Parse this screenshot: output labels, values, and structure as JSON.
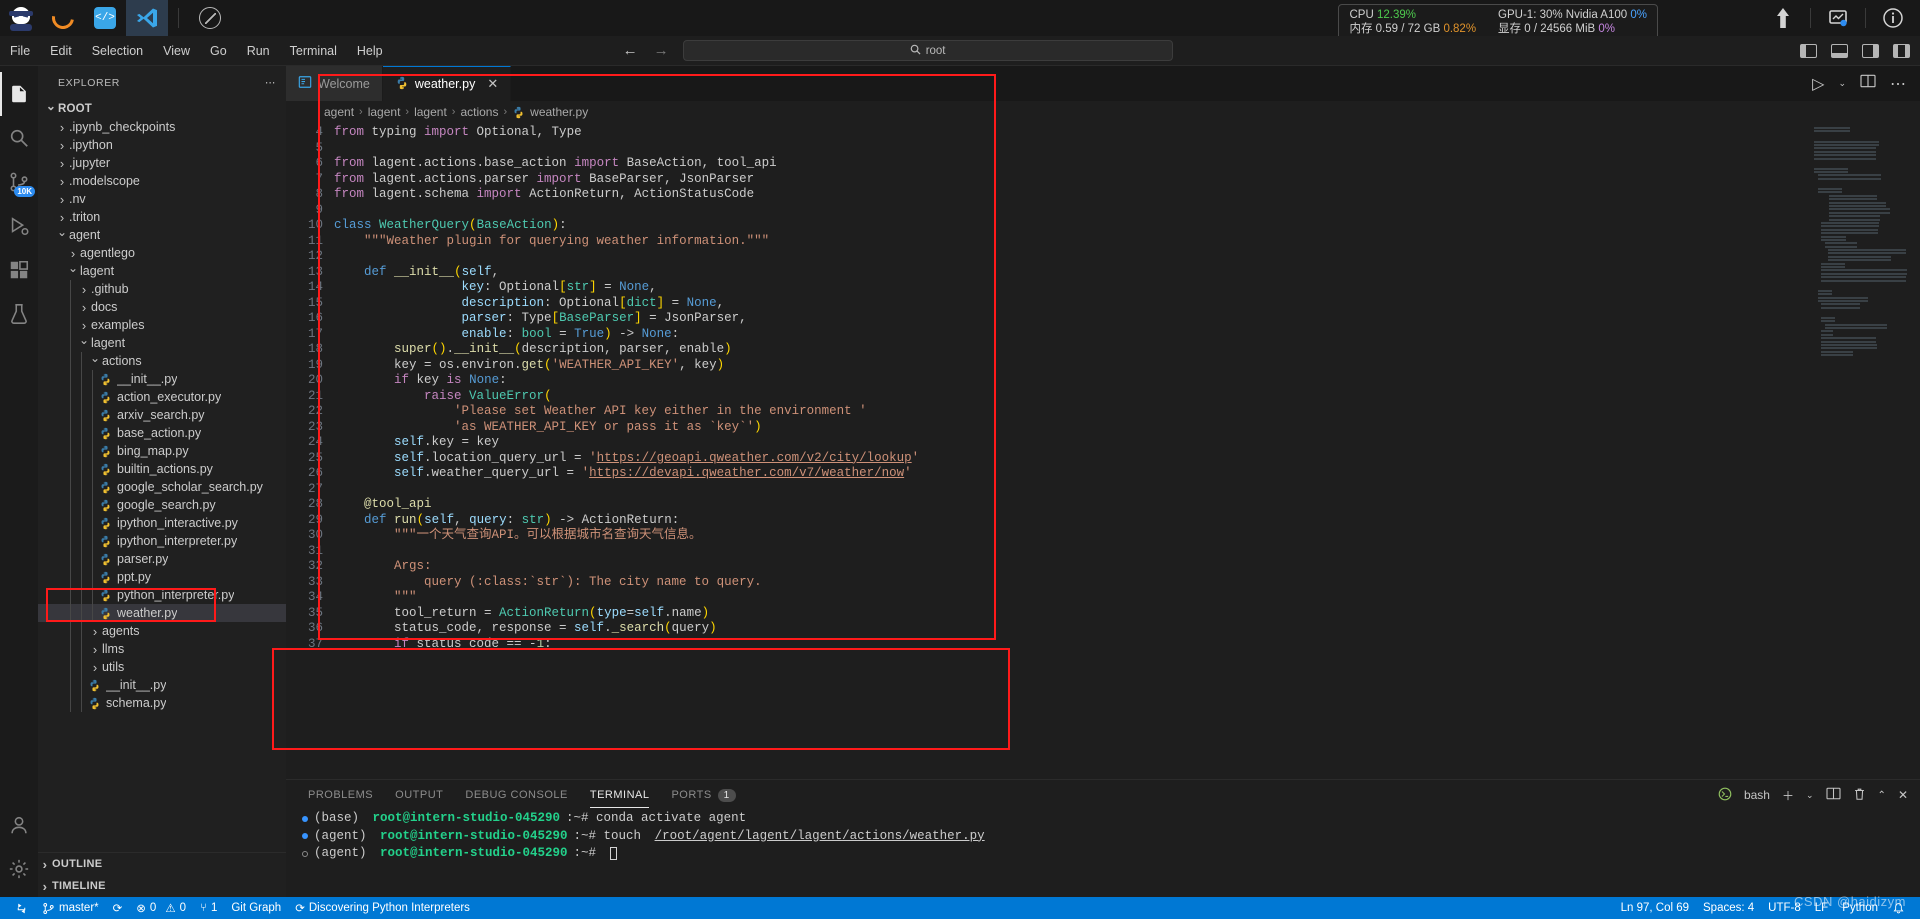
{
  "topstrip": {
    "apps": [
      "ninja-logo",
      "moon-logo",
      "code-logo",
      "vscode-logo"
    ],
    "sysmon": {
      "cpu_label": "CPU",
      "cpu_value": "12.39%",
      "gpu_label": "GPU-1: 30% Nvidia A100",
      "gpu_value": "0%",
      "mem_label": "内存 0.59 / 72 GB",
      "mem_value": "0.82%",
      "vram_label": "显存 0 / 24566 MiB",
      "vram_value": "0%"
    }
  },
  "menubar": {
    "items": [
      "File",
      "Edit",
      "Selection",
      "View",
      "Go",
      "Run",
      "Terminal",
      "Help"
    ],
    "search_value": "root",
    "back_label": "←",
    "forward_label": "→"
  },
  "sidebar": {
    "title": "EXPLORER",
    "root_label": "ROOT",
    "tree": [
      {
        "label": ".ipynb_checkpoints",
        "depth": 1,
        "type": "folder",
        "state": "collapsed"
      },
      {
        "label": ".ipython",
        "depth": 1,
        "type": "folder",
        "state": "collapsed"
      },
      {
        "label": ".jupyter",
        "depth": 1,
        "type": "folder",
        "state": "collapsed"
      },
      {
        "label": ".modelscope",
        "depth": 1,
        "type": "folder",
        "state": "collapsed"
      },
      {
        "label": ".nv",
        "depth": 1,
        "type": "folder",
        "state": "collapsed"
      },
      {
        "label": ".triton",
        "depth": 1,
        "type": "folder",
        "state": "collapsed"
      },
      {
        "label": "agent",
        "depth": 1,
        "type": "folder",
        "state": "expanded"
      },
      {
        "label": "agentlego",
        "depth": 2,
        "type": "folder",
        "state": "collapsed"
      },
      {
        "label": "lagent",
        "depth": 2,
        "type": "folder",
        "state": "expanded"
      },
      {
        "label": ".github",
        "depth": 3,
        "type": "folder",
        "state": "collapsed"
      },
      {
        "label": "docs",
        "depth": 3,
        "type": "folder",
        "state": "collapsed"
      },
      {
        "label": "examples",
        "depth": 3,
        "type": "folder",
        "state": "collapsed"
      },
      {
        "label": "lagent",
        "depth": 3,
        "type": "folder",
        "state": "expanded"
      },
      {
        "label": "actions",
        "depth": 4,
        "type": "folder",
        "state": "expanded"
      },
      {
        "label": "__init__.py",
        "depth": 5,
        "type": "python"
      },
      {
        "label": "action_executor.py",
        "depth": 5,
        "type": "python"
      },
      {
        "label": "arxiv_search.py",
        "depth": 5,
        "type": "python"
      },
      {
        "label": "base_action.py",
        "depth": 5,
        "type": "python"
      },
      {
        "label": "bing_map.py",
        "depth": 5,
        "type": "python"
      },
      {
        "label": "builtin_actions.py",
        "depth": 5,
        "type": "python"
      },
      {
        "label": "google_scholar_search.py",
        "depth": 5,
        "type": "python"
      },
      {
        "label": "google_search.py",
        "depth": 5,
        "type": "python"
      },
      {
        "label": "ipython_interactive.py",
        "depth": 5,
        "type": "python"
      },
      {
        "label": "ipython_interpreter.py",
        "depth": 5,
        "type": "python"
      },
      {
        "label": "parser.py",
        "depth": 5,
        "type": "python"
      },
      {
        "label": "ppt.py",
        "depth": 5,
        "type": "python"
      },
      {
        "label": "python_interpreter.py",
        "depth": 5,
        "type": "python"
      },
      {
        "label": "weather.py",
        "depth": 5,
        "type": "python",
        "selected": true
      },
      {
        "label": "agents",
        "depth": 4,
        "type": "folder",
        "state": "collapsed"
      },
      {
        "label": "llms",
        "depth": 4,
        "type": "folder",
        "state": "collapsed"
      },
      {
        "label": "utils",
        "depth": 4,
        "type": "folder",
        "state": "collapsed"
      },
      {
        "label": "__init__.py",
        "depth": 4,
        "type": "python"
      },
      {
        "label": "schema.py",
        "depth": 4,
        "type": "python"
      }
    ],
    "sections": [
      "OUTLINE",
      "TIMELINE"
    ]
  },
  "editor": {
    "tabs": [
      {
        "label": "Welcome",
        "icon": "welcome-icon",
        "active": false,
        "closable": false
      },
      {
        "label": "weather.py",
        "icon": "python-icon",
        "active": true,
        "closable": true
      }
    ],
    "breadcrumb": [
      "agent",
      "lagent",
      "lagent",
      "actions",
      "weather.py"
    ],
    "first_line_number": 4,
    "code": [
      {
        "n": 4,
        "html": "<span class=\"k\">from</span> typing <span class=\"k\">import</span> Optional, Type"
      },
      {
        "n": 5,
        "html": ""
      },
      {
        "n": 6,
        "html": "<span class=\"k\">from</span> lagent.actions.base_action <span class=\"k\">import</span> BaseAction, tool_api"
      },
      {
        "n": 7,
        "html": "<span class=\"k\">from</span> lagent.actions.parser <span class=\"k\">import</span> BaseParser, JsonParser"
      },
      {
        "n": 8,
        "html": "<span class=\"k\">from</span> lagent.schema <span class=\"k\">import</span> ActionReturn, ActionStatusCode"
      },
      {
        "n": 9,
        "html": ""
      },
      {
        "n": 10,
        "html": "<span class=\"kb\">class</span> <span class=\"cl\">WeatherQuery</span><span class=\"br\">(</span><span class=\"cl\">BaseAction</span><span class=\"br\">)</span>:"
      },
      {
        "n": 11,
        "html": "    <span class=\"st\">\"\"\"Weather plugin for querying weather information.\"\"\"</span>"
      },
      {
        "n": 12,
        "html": ""
      },
      {
        "n": 13,
        "html": "    <span class=\"kb\">def</span> <span class=\"fn\">__init__</span><span class=\"br\">(</span><span class=\"va\">self</span>,"
      },
      {
        "n": 14,
        "html": "                 <span class=\"va\">key</span>: Optional<span class=\"br\">[</span><span class=\"cl\">str</span><span class=\"br\">]</span> = <span class=\"kb\">None</span>,"
      },
      {
        "n": 15,
        "html": "                 <span class=\"va\">description</span>: Optional<span class=\"br\">[</span><span class=\"cl\">dict</span><span class=\"br\">]</span> = <span class=\"kb\">None</span>,"
      },
      {
        "n": 16,
        "html": "                 <span class=\"va\">parser</span>: Type<span class=\"br\">[</span><span class=\"cl\">BaseParser</span><span class=\"br\">]</span> = JsonParser,"
      },
      {
        "n": 17,
        "html": "                 <span class=\"va\">enable</span>: <span class=\"cl\">bool</span> = <span class=\"kb\">True</span><span class=\"br\">)</span> -&gt; <span class=\"kb\">None</span>:"
      },
      {
        "n": 18,
        "html": "        <span class=\"fn\">super</span><span class=\"br\">()</span>.<span class=\"fn\">__init__</span><span class=\"br\">(</span>description, parser, enable<span class=\"br\">)</span>"
      },
      {
        "n": 19,
        "html": "        key = os.environ.<span class=\"fn\">get</span><span class=\"br\">(</span><span class=\"st\">'WEATHER_API_KEY'</span>, key<span class=\"br\">)</span>"
      },
      {
        "n": 20,
        "html": "        <span class=\"k\">if</span> key <span class=\"k\">is</span> <span class=\"kb\">None</span>:"
      },
      {
        "n": 21,
        "html": "            <span class=\"k\">raise</span> <span class=\"cl\">ValueError</span><span class=\"br\">(</span>"
      },
      {
        "n": 22,
        "html": "                <span class=\"st\">'Please set Weather API key either in the environment '</span>"
      },
      {
        "n": 23,
        "html": "                <span class=\"st\">'as WEATHER_API_KEY or pass it as `key`'</span><span class=\"br\">)</span>"
      },
      {
        "n": 24,
        "html": "        <span class=\"va\">self</span>.key = key"
      },
      {
        "n": 25,
        "html": "        <span class=\"va\">self</span>.location_query_url = <span class=\"st\">'</span><span class=\"link\">https://geoapi.qweather.com/v2/city/lookup</span><span class=\"st\">'</span>"
      },
      {
        "n": 26,
        "html": "        <span class=\"va\">self</span>.weather_query_url = <span class=\"st\">'</span><span class=\"link\">https://devapi.qweather.com/v7/weather/now</span><span class=\"st\">'</span>"
      },
      {
        "n": 27,
        "html": ""
      },
      {
        "n": 28,
        "html": "    <span class=\"fn\">@tool_api</span>"
      },
      {
        "n": 29,
        "html": "    <span class=\"kb\">def</span> <span class=\"fn\">run</span><span class=\"br\">(</span><span class=\"va\">self</span>, <span class=\"va\">query</span>: <span class=\"cl\">str</span><span class=\"br\">)</span> -&gt; ActionReturn:"
      },
      {
        "n": 30,
        "html": "        <span class=\"st\">\"\"\"一个天气查询API。可以根据城市名查询天气信息。</span>"
      },
      {
        "n": 31,
        "html": ""
      },
      {
        "n": 32,
        "html": "        <span class=\"st\">Args:</span>"
      },
      {
        "n": 33,
        "html": "            <span class=\"st\">query (:class:`str`): The city name to query.</span>"
      },
      {
        "n": 34,
        "html": "        <span class=\"st\">\"\"\"</span>"
      },
      {
        "n": 35,
        "html": "        tool_return = <span class=\"cl\">ActionReturn</span><span class=\"br\">(</span><span class=\"va\">type</span>=<span class=\"va\">self</span>.name<span class=\"br\">)</span>"
      },
      {
        "n": 36,
        "html": "        status_code, response = <span class=\"va\">self</span>.<span class=\"fn\">_search</span><span class=\"br\">(</span>query<span class=\"br\">)</span>"
      },
      {
        "n": 37,
        "html": "        <span class=\"k\">if</span> status_code == -<span class=\"nu\">1</span>:"
      }
    ]
  },
  "panel": {
    "tabs": [
      {
        "label": "PROBLEMS",
        "active": false
      },
      {
        "label": "OUTPUT",
        "active": false
      },
      {
        "label": "DEBUG CONSOLE",
        "active": false
      },
      {
        "label": "TERMINAL",
        "active": true
      },
      {
        "label": "PORTS",
        "active": false,
        "count": "1"
      }
    ],
    "shell_label": "bash",
    "terminal_lines": [
      {
        "env": "(base)",
        "host": "root@intern-studio-045290",
        "path": "~",
        "prompt": "#",
        "cmd": " conda activate agent",
        "cmd_path": "",
        "cursor": false
      },
      {
        "env": "(agent)",
        "host": "root@intern-studio-045290",
        "path": "~",
        "prompt": "#",
        "cmd": " touch ",
        "cmd_path": "/root/agent/lagent/lagent/actions/weather.py",
        "cursor": false
      },
      {
        "env": "(agent)",
        "host": "root@intern-studio-045290",
        "path": "~",
        "prompt": "#",
        "cmd": " ",
        "cmd_path": "",
        "cursor": true
      }
    ]
  },
  "statusbar": {
    "branch": "master*",
    "sync": "⟳",
    "errors": "0",
    "warnings": "0",
    "ports": "1",
    "git_graph": "Git Graph",
    "discovering": "Discovering Python Interpreters",
    "position": "Ln 97, Col 69",
    "spaces": "Spaces: 4",
    "encoding": "UTF-8",
    "eol": "LF",
    "language": "Python",
    "watermark": "CSDN @haidizym"
  }
}
